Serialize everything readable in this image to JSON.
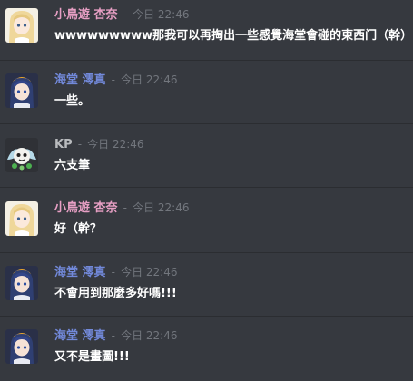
{
  "messages": [
    {
      "author": "小鳥遊 杏奈",
      "color": "#e79fc4",
      "sep": "-",
      "time": "今日 22:46",
      "text": "wwwwwwwww那我可以再掏出一些感覺海堂會碰的東西门（幹）",
      "avatar": "blonde-girl-avatar"
    },
    {
      "author": "海堂 澪真",
      "color": "#7289da",
      "sep": "-",
      "time": "今日 22:46",
      "text": "一些。",
      "avatar": "navy-hair-girl-avatar"
    },
    {
      "author": "KP",
      "color": "#b9bbbe",
      "sep": "-",
      "time": "今日 22:46",
      "text": "六支筆",
      "avatar": "cartoon-mascot-avatar"
    },
    {
      "author": "小鳥遊 杏奈",
      "color": "#e79fc4",
      "sep": "-",
      "time": "今日 22:46",
      "text": "好（幹？",
      "avatar": "blonde-girl-avatar"
    },
    {
      "author": "海堂 澪真",
      "color": "#7289da",
      "sep": "-",
      "time": "今日 22:46",
      "text": "不會用到那麼多好嗎!!!",
      "avatar": "navy-hair-girl-avatar"
    },
    {
      "author": "海堂 澪真",
      "color": "#7289da",
      "sep": "-",
      "time": "今日 22:46",
      "text": "又不是畫圖!!!",
      "avatar": "navy-hair-girl-avatar"
    }
  ]
}
